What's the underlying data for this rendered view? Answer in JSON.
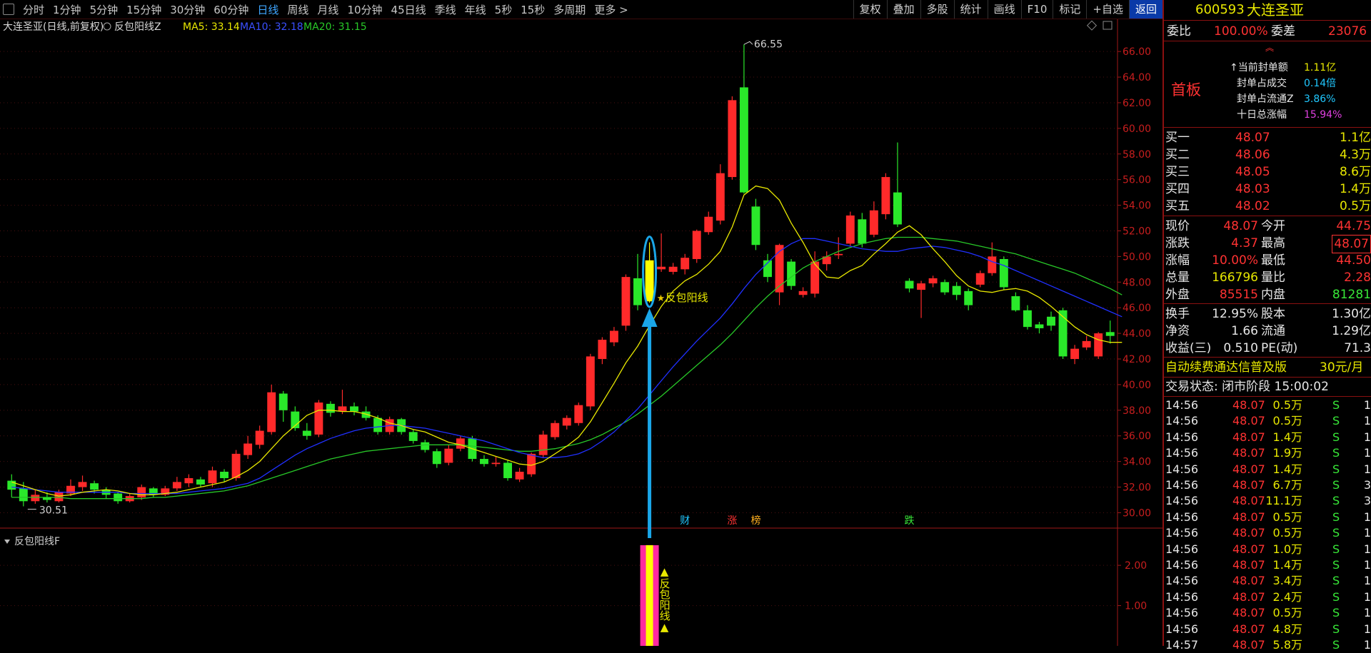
{
  "toolbar": {
    "periods": [
      "分时",
      "1分钟",
      "5分钟",
      "15分钟",
      "30分钟",
      "60分钟",
      "日线",
      "周线",
      "月线",
      "10分钟",
      "45日线",
      "季线",
      "年线",
      "5秒",
      "15秒",
      "多周期",
      "更多 >"
    ],
    "active_period": "日线",
    "right_buttons": [
      "复权",
      "叠加",
      "多股",
      "统计",
      "画线",
      "F10",
      "标记",
      "+自选",
      "返回"
    ]
  },
  "chart_info": {
    "stock_title": "大连圣亚(日线,前复权)",
    "indicator_name": "反包阳线Z",
    "ma5_label": "MA5: 33.14",
    "ma10_label": "MA10: 32.18",
    "ma20_label": "MA20: 31.15"
  },
  "colors": {
    "up": "#ff2a2a",
    "down": "#2ae82a",
    "ma5": "#e8e800",
    "ma10": "#2030ff",
    "ma20": "#28c828",
    "highlight": "#ffff00",
    "ellipse": "#1aa6e8",
    "arrow": "#1aa6e8",
    "bar_pink": "#ff2aa0"
  },
  "chart_data": {
    "type": "candlestick",
    "ylim": [
      28.8,
      67.4
    ],
    "y_ticks": [
      "66.00",
      "64.00",
      "62.00",
      "60.00",
      "58.00",
      "56.00",
      "54.00",
      "52.00",
      "50.00",
      "48.00",
      "46.00",
      "44.00",
      "42.00",
      "40.00",
      "38.00",
      "36.00",
      "34.00",
      "32.00",
      "30.00"
    ],
    "candles": [
      {
        "o": 32.5,
        "c": 31.8,
        "h": 33.0,
        "l": 31.2
      },
      {
        "o": 31.9,
        "c": 30.9,
        "h": 32.4,
        "l": 30.5
      },
      {
        "o": 30.9,
        "c": 31.4,
        "h": 31.8,
        "l": 30.7
      },
      {
        "o": 31.2,
        "c": 31.0,
        "h": 31.6,
        "l": 30.8
      },
      {
        "o": 30.9,
        "c": 31.6,
        "h": 31.8,
        "l": 30.8
      },
      {
        "o": 31.5,
        "c": 32.1,
        "h": 32.6,
        "l": 31.3
      },
      {
        "o": 32.0,
        "c": 32.4,
        "h": 32.9,
        "l": 31.7
      },
      {
        "o": 32.3,
        "c": 31.8,
        "h": 32.5,
        "l": 31.5
      },
      {
        "o": 31.8,
        "c": 31.4,
        "h": 32.0,
        "l": 31.1
      },
      {
        "o": 31.5,
        "c": 30.9,
        "h": 31.6,
        "l": 30.7
      },
      {
        "o": 30.9,
        "c": 31.3,
        "h": 31.5,
        "l": 30.8
      },
      {
        "o": 31.2,
        "c": 32.0,
        "h": 32.2,
        "l": 31.0
      },
      {
        "o": 31.9,
        "c": 31.4,
        "h": 32.0,
        "l": 31.2
      },
      {
        "o": 31.4,
        "c": 31.9,
        "h": 32.1,
        "l": 31.3
      },
      {
        "o": 31.9,
        "c": 32.4,
        "h": 32.8,
        "l": 31.7
      },
      {
        "o": 32.3,
        "c": 32.7,
        "h": 33.0,
        "l": 32.0
      },
      {
        "o": 32.6,
        "c": 32.2,
        "h": 32.8,
        "l": 32.0
      },
      {
        "o": 32.3,
        "c": 33.3,
        "h": 33.6,
        "l": 32.0
      },
      {
        "o": 33.2,
        "c": 32.7,
        "h": 33.4,
        "l": 32.4
      },
      {
        "o": 32.7,
        "c": 34.6,
        "h": 34.9,
        "l": 32.5
      },
      {
        "o": 34.5,
        "c": 35.4,
        "h": 36.0,
        "l": 34.2
      },
      {
        "o": 35.3,
        "c": 36.4,
        "h": 36.8,
        "l": 35.0
      },
      {
        "o": 36.3,
        "c": 39.4,
        "h": 40.0,
        "l": 36.1
      },
      {
        "o": 39.3,
        "c": 38.0,
        "h": 39.5,
        "l": 37.1
      },
      {
        "o": 37.9,
        "c": 36.6,
        "h": 38.3,
        "l": 36.4
      },
      {
        "o": 36.4,
        "c": 36.0,
        "h": 37.0,
        "l": 35.7
      },
      {
        "o": 36.1,
        "c": 38.6,
        "h": 38.8,
        "l": 35.9
      },
      {
        "o": 38.5,
        "c": 37.8,
        "h": 38.7,
        "l": 37.5
      },
      {
        "o": 37.9,
        "c": 38.3,
        "h": 39.6,
        "l": 37.7
      },
      {
        "o": 38.3,
        "c": 37.9,
        "h": 38.6,
        "l": 37.6
      },
      {
        "o": 37.9,
        "c": 37.4,
        "h": 38.3,
        "l": 37.2
      },
      {
        "o": 37.4,
        "c": 36.3,
        "h": 37.6,
        "l": 36.1
      },
      {
        "o": 36.3,
        "c": 37.3,
        "h": 37.5,
        "l": 36.1
      },
      {
        "o": 37.3,
        "c": 36.3,
        "h": 37.4,
        "l": 36.1
      },
      {
        "o": 36.3,
        "c": 35.6,
        "h": 36.5,
        "l": 35.4
      },
      {
        "o": 35.5,
        "c": 34.9,
        "h": 35.7,
        "l": 34.7
      },
      {
        "o": 34.8,
        "c": 33.8,
        "h": 35.0,
        "l": 33.5
      },
      {
        "o": 33.9,
        "c": 35.0,
        "h": 35.3,
        "l": 33.7
      },
      {
        "o": 35.0,
        "c": 35.8,
        "h": 36.0,
        "l": 34.8
      },
      {
        "o": 35.8,
        "c": 34.2,
        "h": 36.0,
        "l": 34.0
      },
      {
        "o": 34.2,
        "c": 33.8,
        "h": 34.5,
        "l": 33.6
      },
      {
        "o": 33.8,
        "c": 33.9,
        "h": 34.4,
        "l": 33.6
      },
      {
        "o": 33.9,
        "c": 32.7,
        "h": 34.1,
        "l": 32.5
      },
      {
        "o": 32.6,
        "c": 33.2,
        "h": 33.5,
        "l": 32.4
      },
      {
        "o": 33.0,
        "c": 34.6,
        "h": 34.7,
        "l": 32.8
      },
      {
        "o": 34.5,
        "c": 36.1,
        "h": 36.4,
        "l": 34.3
      },
      {
        "o": 35.9,
        "c": 37.0,
        "h": 37.2,
        "l": 35.7
      },
      {
        "o": 36.8,
        "c": 37.4,
        "h": 37.6,
        "l": 36.5
      },
      {
        "o": 37.0,
        "c": 38.4,
        "h": 38.6,
        "l": 36.8
      },
      {
        "o": 38.3,
        "c": 42.2,
        "h": 42.4,
        "l": 38.0
      },
      {
        "o": 42.0,
        "c": 43.5,
        "h": 43.7,
        "l": 41.6
      },
      {
        "o": 43.3,
        "c": 44.2,
        "h": 44.5,
        "l": 43.0
      },
      {
        "o": 44.6,
        "c": 48.4,
        "h": 48.6,
        "l": 44.2
      },
      {
        "o": 48.3,
        "c": 46.2,
        "h": 50.2,
        "l": 45.8
      },
      {
        "o": 46.5,
        "c": 49.7,
        "h": 51.1,
        "l": 46.4
      },
      {
        "o": 49.0,
        "c": 49.2,
        "h": 51.8,
        "l": 48.8
      },
      {
        "o": 48.8,
        "c": 49.2,
        "h": 49.5,
        "l": 48.6
      },
      {
        "o": 49.0,
        "c": 49.9,
        "h": 50.2,
        "l": 48.6
      },
      {
        "o": 49.8,
        "c": 52.0,
        "h": 52.1,
        "l": 49.5
      },
      {
        "o": 51.9,
        "c": 53.1,
        "h": 53.5,
        "l": 51.7
      },
      {
        "o": 52.8,
        "c": 56.5,
        "h": 57.2,
        "l": 52.5
      },
      {
        "o": 56.2,
        "c": 62.2,
        "h": 62.5,
        "l": 56.0
      },
      {
        "o": 63.2,
        "c": 55.0,
        "h": 66.55,
        "l": 54.9
      },
      {
        "o": 53.9,
        "c": 50.9,
        "h": 54.5,
        "l": 50.5
      },
      {
        "o": 49.7,
        "c": 48.4,
        "h": 50.2,
        "l": 48.0
      },
      {
        "o": 47.2,
        "c": 50.9,
        "h": 51.0,
        "l": 46.2
      },
      {
        "o": 49.6,
        "c": 47.7,
        "h": 49.8,
        "l": 47.4
      },
      {
        "o": 47.0,
        "c": 47.3,
        "h": 47.6,
        "l": 46.8
      },
      {
        "o": 47.1,
        "c": 49.6,
        "h": 50.4,
        "l": 46.8
      },
      {
        "o": 49.4,
        "c": 50.0,
        "h": 50.4,
        "l": 48.9
      },
      {
        "o": 50.1,
        "c": 50.2,
        "h": 51.5,
        "l": 49.8
      },
      {
        "o": 51.0,
        "c": 53.2,
        "h": 53.5,
        "l": 50.8
      },
      {
        "o": 52.9,
        "c": 51.0,
        "h": 53.4,
        "l": 50.7
      },
      {
        "o": 51.7,
        "c": 53.6,
        "h": 54.3,
        "l": 51.5
      },
      {
        "o": 53.3,
        "c": 56.2,
        "h": 56.5,
        "l": 52.9
      },
      {
        "o": 55.0,
        "c": 52.5,
        "h": 58.9,
        "l": 52.3
      },
      {
        "o": 48.1,
        "c": 47.5,
        "h": 48.3,
        "l": 47.2
      },
      {
        "o": 47.4,
        "c": 47.9,
        "h": 48.1,
        "l": 45.2
      },
      {
        "o": 47.9,
        "c": 48.3,
        "h": 48.5,
        "l": 47.6
      },
      {
        "o": 48.0,
        "c": 47.2,
        "h": 48.2,
        "l": 47.0
      },
      {
        "o": 47.7,
        "c": 47.0,
        "h": 48.0,
        "l": 46.6
      },
      {
        "o": 47.3,
        "c": 46.2,
        "h": 47.5,
        "l": 45.8
      },
      {
        "o": 47.8,
        "c": 48.7,
        "h": 48.9,
        "l": 47.6
      },
      {
        "o": 48.7,
        "c": 50.0,
        "h": 51.1,
        "l": 48.5
      },
      {
        "o": 49.8,
        "c": 47.6,
        "h": 50.0,
        "l": 47.4
      },
      {
        "o": 46.9,
        "c": 45.8,
        "h": 47.2,
        "l": 45.7
      },
      {
        "o": 45.8,
        "c": 44.5,
        "h": 46.2,
        "l": 44.3
      },
      {
        "o": 44.7,
        "c": 44.4,
        "h": 44.9,
        "l": 44.0
      },
      {
        "o": 45.3,
        "c": 44.6,
        "h": 45.7,
        "l": 44.2
      },
      {
        "o": 45.8,
        "c": 42.2,
        "h": 46.0,
        "l": 42.0
      },
      {
        "o": 42.0,
        "c": 42.8,
        "h": 43.1,
        "l": 41.6
      },
      {
        "o": 42.9,
        "c": 43.4,
        "h": 43.8,
        "l": 42.7
      },
      {
        "o": 42.2,
        "c": 44.0,
        "h": 44.1,
        "l": 42.0
      },
      {
        "o": 44.1,
        "c": 43.8,
        "h": 45.0,
        "l": 43.2
      }
    ],
    "ma5": [
      32.4,
      32.1,
      31.8,
      31.5,
      31.3,
      31.4,
      31.6,
      31.7,
      31.8,
      31.7,
      31.5,
      31.4,
      31.4,
      31.5,
      31.6,
      31.8,
      32.0,
      32.2,
      32.4,
      32.8,
      33.3,
      34.0,
      35.0,
      36.0,
      36.8,
      37.6,
      38.0,
      38.0,
      37.9,
      37.9,
      37.7,
      37.4,
      37.0,
      36.8,
      36.5,
      36.3,
      35.9,
      35.5,
      35.3,
      35.0,
      34.7,
      34.4,
      34.1,
      33.8,
      33.7,
      34.0,
      34.6,
      35.2,
      35.9,
      37.1,
      38.6,
      40.1,
      41.7,
      43.0,
      44.6,
      46.1,
      47.3,
      48.1,
      48.6,
      49.4,
      50.4,
      52.3,
      54.8,
      55.5,
      55.3,
      54.4,
      52.6,
      51.1,
      49.4,
      48.4,
      48.3,
      48.9,
      49.3,
      50.2,
      51.0,
      51.9,
      52.4,
      51.7,
      50.6,
      49.6,
      48.5,
      47.7,
      47.3,
      47.2,
      47.4,
      47.5,
      47.3,
      46.8,
      46.1,
      45.3,
      44.5,
      43.9,
      43.5,
      43.3,
      43.3
    ],
    "ma10": [
      32.0,
      31.9,
      31.8,
      31.7,
      31.6,
      31.6,
      31.6,
      31.6,
      31.6,
      31.6,
      31.5,
      31.5,
      31.5,
      31.5,
      31.5,
      31.6,
      31.7,
      31.8,
      31.9,
      32.1,
      32.3,
      32.7,
      33.3,
      33.9,
      34.5,
      35.0,
      35.4,
      35.8,
      36.1,
      36.4,
      36.6,
      36.7,
      36.8,
      36.8,
      36.7,
      36.6,
      36.4,
      36.2,
      36.0,
      35.8,
      35.6,
      35.3,
      35.0,
      34.7,
      34.5,
      34.3,
      34.3,
      34.4,
      34.6,
      35.0,
      35.6,
      36.3,
      37.2,
      38.1,
      39.2,
      40.3,
      41.4,
      42.4,
      43.4,
      44.3,
      45.2,
      46.3,
      47.5,
      48.6,
      49.5,
      50.4,
      51.0,
      51.4,
      51.4,
      51.2,
      51.0,
      50.8,
      50.6,
      50.5,
      50.4,
      50.4,
      50.6,
      50.7,
      50.8,
      50.7,
      50.5,
      50.3,
      50.0,
      49.6,
      49.3,
      48.9,
      48.5,
      48.1,
      47.7,
      47.3,
      46.9,
      46.5,
      46.1,
      45.7,
      45.3
    ],
    "ma20": [
      31.2,
      31.2,
      31.2,
      31.2,
      31.2,
      31.1,
      31.1,
      31.1,
      31.1,
      31.1,
      31.1,
      31.1,
      31.2,
      31.2,
      31.3,
      31.4,
      31.5,
      31.6,
      31.7,
      31.9,
      32.1,
      32.4,
      32.7,
      33.0,
      33.3,
      33.6,
      33.9,
      34.2,
      34.4,
      34.6,
      34.8,
      34.9,
      35.0,
      35.1,
      35.2,
      35.3,
      35.3,
      35.3,
      35.3,
      35.2,
      35.1,
      35.0,
      34.9,
      34.8,
      34.8,
      34.9,
      35.0,
      35.2,
      35.4,
      35.7,
      36.1,
      36.6,
      37.1,
      37.7,
      38.4,
      39.1,
      39.9,
      40.7,
      41.5,
      42.3,
      43.1,
      44.0,
      45.0,
      46.0,
      46.9,
      47.7,
      48.4,
      49.1,
      49.6,
      50.0,
      50.4,
      50.7,
      51.0,
      51.2,
      51.4,
      51.5,
      51.5,
      51.5,
      51.4,
      51.3,
      51.2,
      51.0,
      50.8,
      50.6,
      50.4,
      50.2,
      49.9,
      49.6,
      49.3,
      49.0,
      48.7,
      48.3,
      47.9,
      47.5,
      47.0
    ],
    "signal_index": 54,
    "signal_label": "反包阳线",
    "high_label": "66.55",
    "low_label": "30.51",
    "bottom_markers": [
      {
        "index": 57,
        "text": "财",
        "color": "#20c8ff"
      },
      {
        "index": 61,
        "text": "涨",
        "color": "#ff3232"
      },
      {
        "index": 63,
        "text": "榜",
        "color": "#ffb020"
      },
      {
        "index": 76,
        "text": "跌",
        "color": "#38e838"
      }
    ],
    "sub_indicator": {
      "name": "反包阳线F",
      "ylim": [
        0,
        2.8
      ],
      "y_ticks": [
        "2.00",
        "1.00"
      ],
      "signal_value": 2.5,
      "vertical_label": "▲反包阳线▲"
    }
  },
  "panel": {
    "code": "600593",
    "name": "大连圣亚",
    "weibi_label": "委比",
    "weibi_value": "100.00%",
    "weicha_label": "委差",
    "weicha_value": "23076",
    "board_label": "首板",
    "seal_stats": [
      {
        "label": "当前封单额",
        "value": "1.11亿",
        "color": "yellow"
      },
      {
        "label": "封单占成交",
        "value": "0.14倍",
        "color": "cyan"
      },
      {
        "label": "封单占流通Z",
        "value": "3.86%",
        "color": "cyan"
      },
      {
        "label": "十日总涨幅",
        "value": "15.94%",
        "color": "purple"
      }
    ],
    "bids": [
      {
        "label": "买一",
        "price": "48.07",
        "vol": "1.1亿"
      },
      {
        "label": "买二",
        "price": "48.06",
        "vol": "4.3万"
      },
      {
        "label": "买三",
        "price": "48.05",
        "vol": "8.6万"
      },
      {
        "label": "买四",
        "price": "48.03",
        "vol": "1.4万"
      },
      {
        "label": "买五",
        "price": "48.02",
        "vol": "0.5万"
      }
    ],
    "quote": [
      {
        "l1": "现价",
        "v1": "48.07",
        "c1": "red",
        "l2": "今开",
        "v2": "44.75",
        "c2": "red"
      },
      {
        "l1": "涨跌",
        "v1": "4.37",
        "c1": "red",
        "l2": "最高",
        "v2": "48.07",
        "c2": "red"
      },
      {
        "l1": "涨幅",
        "v1": "10.00%",
        "c1": "red",
        "l2": "最低",
        "v2": "44.50",
        "c2": "red"
      },
      {
        "l1": "总量",
        "v1": "166796",
        "c1": "yellow",
        "l2": "量比",
        "v2": "2.28",
        "c2": "red"
      },
      {
        "l1": "外盘",
        "v1": "85515",
        "c1": "red",
        "l2": "内盘",
        "v2": "81281",
        "c2": "green"
      }
    ],
    "fundamentals": [
      {
        "l1": "换手",
        "v1": "12.95%",
        "l2": "股本",
        "v2": "1.30亿"
      },
      {
        "l1": "净资",
        "v1": "1.66",
        "l2": "流通",
        "v2": "1.29亿"
      },
      {
        "l1": "收益(三)",
        "v1": "0.510",
        "l2": "PE(动)",
        "v2": "71.3"
      }
    ],
    "ad_text": "自动续费通达信普及版",
    "ad_price": "30元/月",
    "trade_status": "交易状态: 闭市阶段 15:00:02",
    "ticks": [
      {
        "t": "14:56",
        "p": "48.07",
        "v": "0.5万",
        "s": "S",
        "n": "1"
      },
      {
        "t": "14:56",
        "p": "48.07",
        "v": "0.5万",
        "s": "S",
        "n": "1"
      },
      {
        "t": "14:56",
        "p": "48.07",
        "v": "1.4万",
        "s": "S",
        "n": "1"
      },
      {
        "t": "14:56",
        "p": "48.07",
        "v": "1.9万",
        "s": "S",
        "n": "1"
      },
      {
        "t": "14:56",
        "p": "48.07",
        "v": "1.4万",
        "s": "S",
        "n": "1"
      },
      {
        "t": "14:56",
        "p": "48.07",
        "v": "6.7万",
        "s": "S",
        "n": "3"
      },
      {
        "t": "14:56",
        "p": "48.07",
        "v": "11.1万",
        "s": "S",
        "n": "3"
      },
      {
        "t": "14:56",
        "p": "48.07",
        "v": "0.5万",
        "s": "S",
        "n": "1"
      },
      {
        "t": "14:56",
        "p": "48.07",
        "v": "0.5万",
        "s": "S",
        "n": "1"
      },
      {
        "t": "14:56",
        "p": "48.07",
        "v": "1.0万",
        "s": "S",
        "n": "1"
      },
      {
        "t": "14:56",
        "p": "48.07",
        "v": "1.4万",
        "s": "S",
        "n": "1"
      },
      {
        "t": "14:56",
        "p": "48.07",
        "v": "3.4万",
        "s": "S",
        "n": "1"
      },
      {
        "t": "14:56",
        "p": "48.07",
        "v": "2.4万",
        "s": "S",
        "n": "1"
      },
      {
        "t": "14:56",
        "p": "48.07",
        "v": "0.5万",
        "s": "S",
        "n": "1"
      },
      {
        "t": "14:56",
        "p": "48.07",
        "v": "4.8万",
        "s": "S",
        "n": "1"
      },
      {
        "t": "14:57",
        "p": "48.07",
        "v": "5.8万",
        "s": "S",
        "n": "1"
      }
    ]
  }
}
